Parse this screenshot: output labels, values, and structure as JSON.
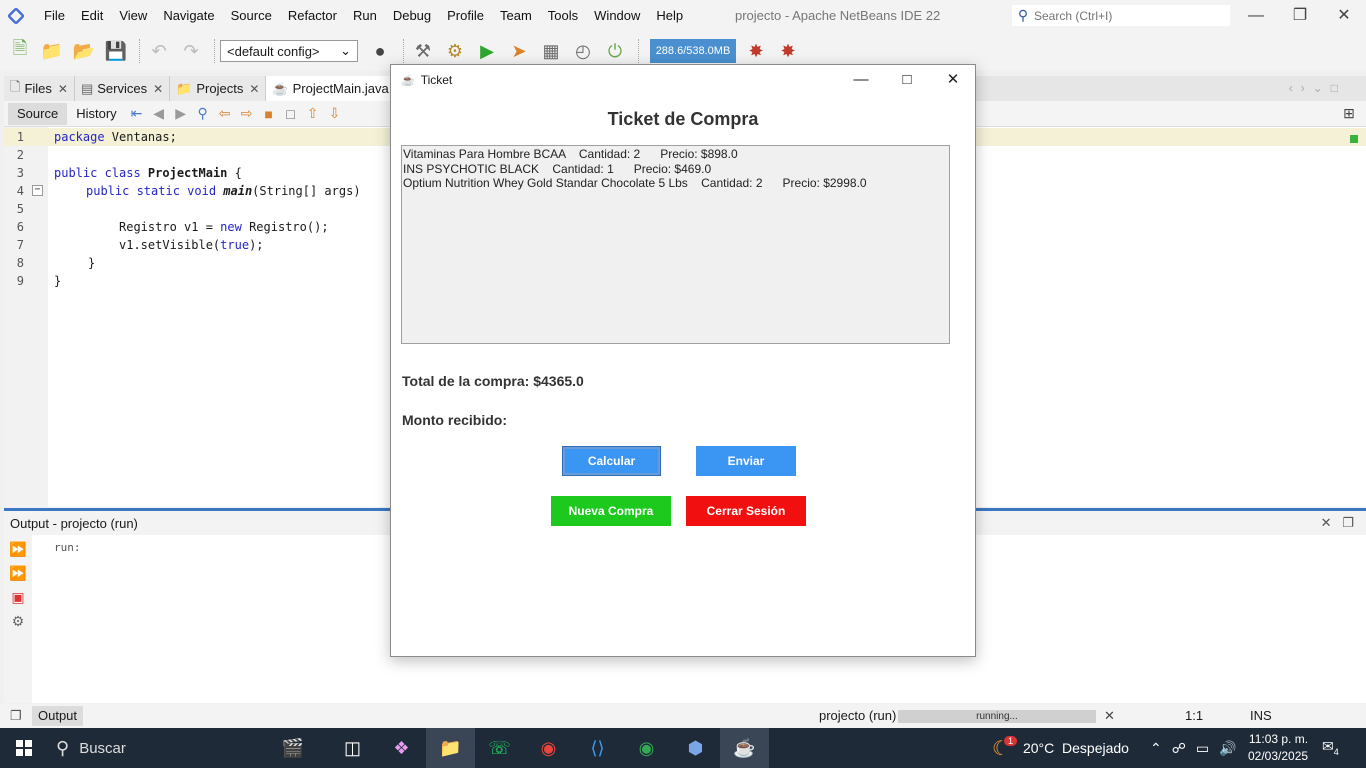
{
  "app": {
    "title": "projecto - Apache NetBeans IDE 22",
    "menu": [
      "File",
      "Edit",
      "View",
      "Navigate",
      "Source",
      "Refactor",
      "Run",
      "Debug",
      "Profile",
      "Team",
      "Tools",
      "Window",
      "Help"
    ],
    "search_placeholder": "Search (Ctrl+I)"
  },
  "toolbar": {
    "config": "<default config>",
    "memory": "288.6/538.0MB"
  },
  "editor": {
    "tabs": [
      {
        "label": "Files"
      },
      {
        "label": "Services"
      },
      {
        "label": "Projects"
      },
      {
        "label": "ProjectMain.java"
      }
    ],
    "source_label": "Source",
    "history_label": "History",
    "line_numbers": [
      "1",
      "2",
      "3",
      "4",
      "5",
      "6",
      "7",
      "8",
      "9"
    ],
    "code": {
      "l1_kw": "package",
      "l1_rest": " Ventanas;",
      "l3_kw": "public class",
      "l3_name": " ProjectMain",
      "l3_rest": " {",
      "l4_kw": "public static void",
      "l4_name": " main",
      "l4_rest": "(String[] args)",
      "l6_pre": "Registro v1 = ",
      "l6_kw": "new",
      "l6_rest": " Registro();",
      "l7_pre": "v1.setVisible(",
      "l7_kw": "true",
      "l7_rest": ");",
      "l8": "}",
      "l9": "}"
    }
  },
  "output": {
    "title": "Output - projecto (run)",
    "text": "run:"
  },
  "status": {
    "tab": "Output",
    "project": "projecto (run)",
    "progress_text": "running...",
    "position": "1:1",
    "mode": "INS"
  },
  "taskbar": {
    "search": "Buscar",
    "weather": "20°C  Despejado",
    "weather_badge": "1",
    "time": "11:03 p. m.",
    "date": "02/03/2025",
    "notifications": "4"
  },
  "dialog": {
    "title": "Ticket",
    "heading": "Ticket de Compra",
    "ticket_lines": [
      "Vitaminas Para Hombre BCAA    Cantidad: 2      Precio: $898.0",
      "INS PSYCHOTIC BLACK    Cantidad: 1      Precio: $469.0",
      "Optium Nutrition Whey Gold Standar Chocolate 5 Lbs    Cantidad: 2      Precio: $2998.0"
    ],
    "total": "Total de la compra: $4365.0",
    "monto": "Monto recibido:",
    "btn_calcular": "Calcular",
    "btn_enviar": "Enviar",
    "btn_nueva": "Nueva Compra",
    "btn_cerrar": "Cerrar Sesión",
    "colors": {
      "blue": "#3b95f3",
      "green": "#1ec91e",
      "red": "#f20f0f"
    }
  }
}
